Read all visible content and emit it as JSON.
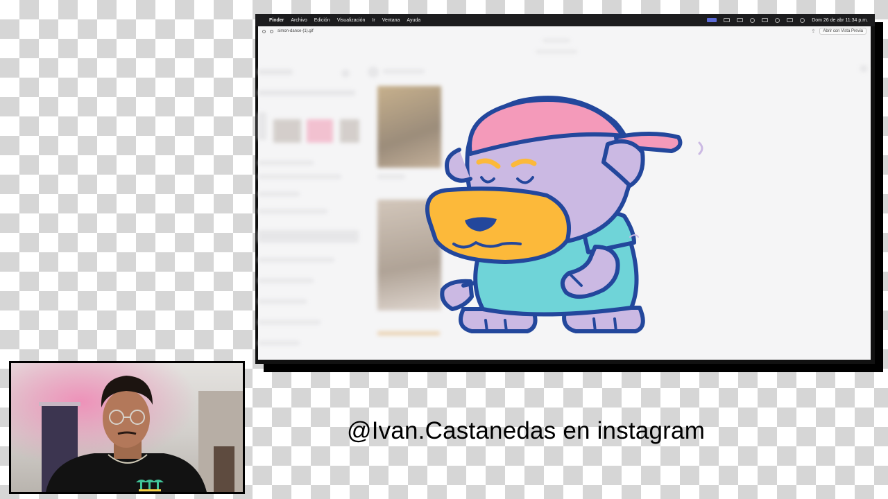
{
  "menubar": {
    "items": [
      "Finder",
      "Archivo",
      "Edición",
      "Visualización",
      "Ir",
      "Ventana",
      "Ayuda"
    ],
    "datetime": "Dom 26 de abr  11:34 p.m."
  },
  "quicklook": {
    "filename": "simon-dance-(1).gif",
    "open_with_label": "Abrir con Vista Previa"
  },
  "caption": "@Ivan.Castanedas en instagram",
  "colors": {
    "outline": "#23479c",
    "cap_pink": "#f49aba",
    "body_lavender": "#cbb9e3",
    "muzzle_yellow": "#fcb93a",
    "shirt_teal": "#6fd4d8"
  }
}
